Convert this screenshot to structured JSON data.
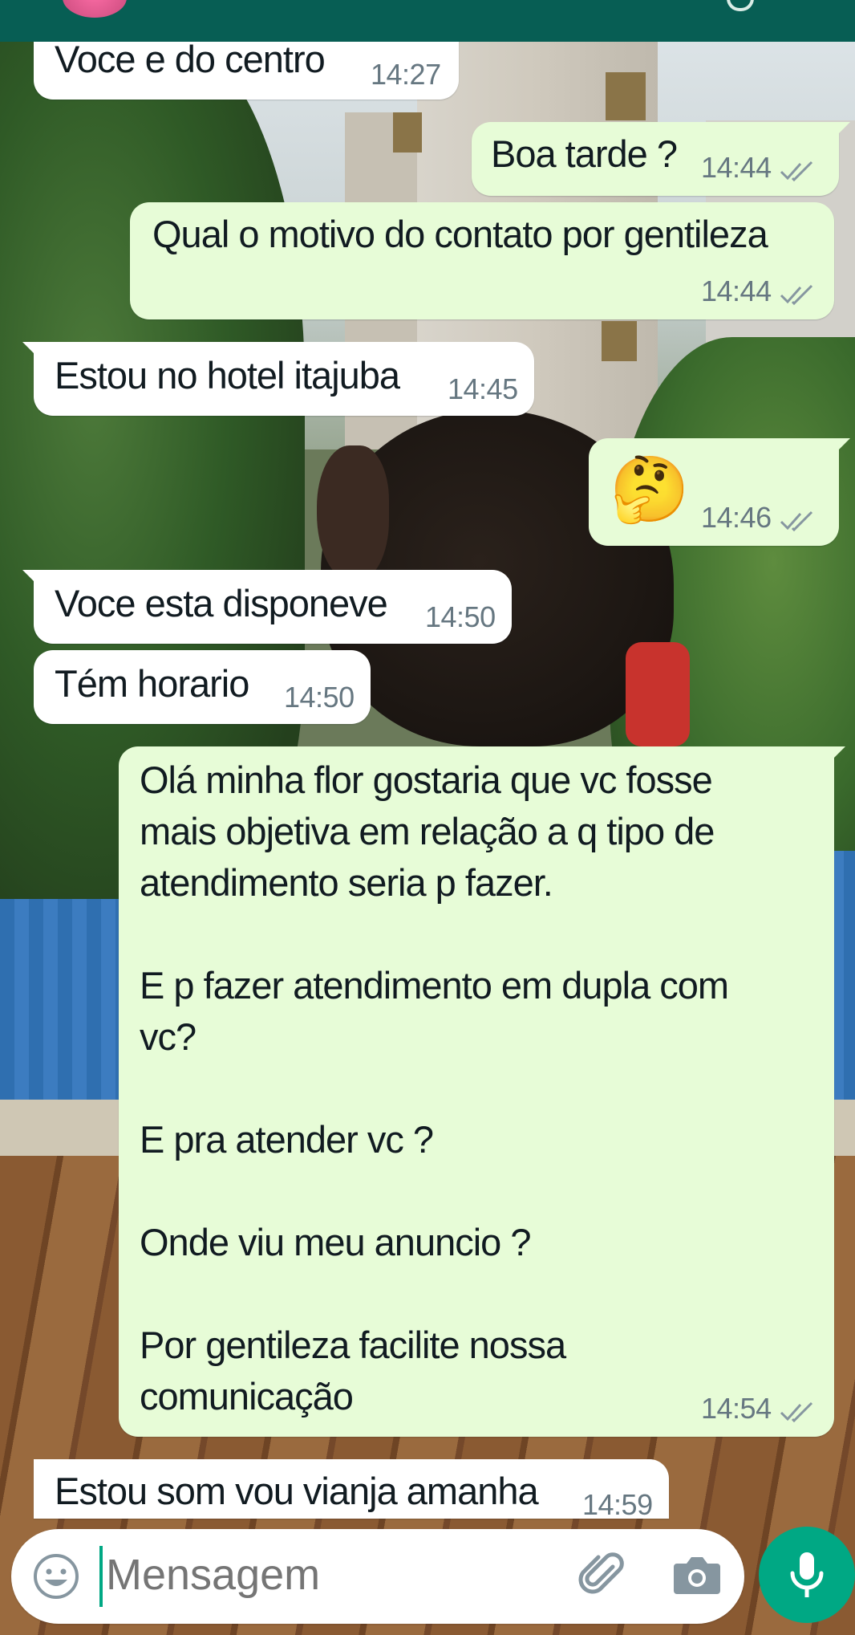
{
  "colors": {
    "header": "#075e54",
    "incoming_bubble": "#ffffff",
    "outgoing_bubble": "#e7fcd7",
    "read_ticks": "#8696a0",
    "accent": "#00a884"
  },
  "header": {
    "avatar_icon": "contact-avatar",
    "action_icon": "phone-icon"
  },
  "messages": [
    {
      "direction": "in",
      "text": "Voce e do centro",
      "time": "14:27"
    },
    {
      "direction": "out",
      "text": "Boa tarde ?",
      "time": "14:44",
      "status_icon": "double-check-icon"
    },
    {
      "direction": "out",
      "text": "Qual o motivo do contato por gentileza",
      "time": "14:44",
      "status_icon": "double-check-icon"
    },
    {
      "direction": "in",
      "text": "Estou no hotel itajuba",
      "time": "14:45"
    },
    {
      "direction": "out",
      "text": "🤔",
      "time": "14:46",
      "status_icon": "double-check-icon"
    },
    {
      "direction": "in",
      "text": "Voce esta disponeve",
      "time": "14:50"
    },
    {
      "direction": "in",
      "text": "Tém horario",
      "time": "14:50"
    },
    {
      "direction": "out",
      "text": "Olá minha flor gostaria que vc fosse\nmais objetiva em relação a q tipo de\natendimento seria p fazer.\n\nE p fazer atendimento em dupla com\nvc?\n\nE pra atender vc ?\n\nOnde viu meu anuncio ?\n\nPor gentileza facilite nossa\ncomunicação",
      "time": "14:54",
      "status_icon": "double-check-icon"
    },
    {
      "direction": "in",
      "text": "Estou som vou vianja amanha",
      "time": "14:59"
    }
  ],
  "composer": {
    "placeholder": "Mensagem",
    "emoji_icon": "emoji-icon",
    "attach_icon": "paperclip-icon",
    "camera_icon": "camera-icon",
    "mic_icon": "microphone-icon"
  }
}
